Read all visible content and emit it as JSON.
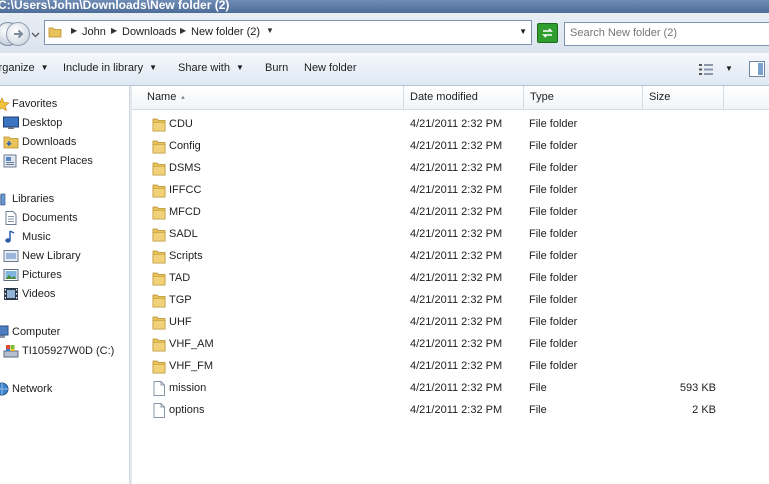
{
  "window": {
    "title": "C:\\Users\\John\\Downloads\\New folder (2)"
  },
  "address": {
    "crumbs": [
      "John",
      "Downloads",
      "New folder (2)"
    ]
  },
  "search": {
    "placeholder": "Search New folder (2)"
  },
  "toolbar": {
    "organize": "Organize",
    "include": "Include in library",
    "share": "Share with",
    "burn": "Burn",
    "newfolder": "New folder"
  },
  "nav": {
    "favorites": "Favorites",
    "desktop": "Desktop",
    "downloads": "Downloads",
    "recent": "Recent Places",
    "libraries": "Libraries",
    "documents": "Documents",
    "music": "Music",
    "newlibrary": "New Library",
    "pictures": "Pictures",
    "videos": "Videos",
    "computer": "Computer",
    "drive": "TI105927W0D (C:)",
    "network": "Network"
  },
  "columns": {
    "name": "Name",
    "date": "Date modified",
    "type": "Type",
    "size": "Size"
  },
  "files": [
    {
      "name": "CDU",
      "date": "4/21/2011 2:32 PM",
      "type": "File folder",
      "size": ""
    },
    {
      "name": "Config",
      "date": "4/21/2011 2:32 PM",
      "type": "File folder",
      "size": ""
    },
    {
      "name": "DSMS",
      "date": "4/21/2011 2:32 PM",
      "type": "File folder",
      "size": ""
    },
    {
      "name": "IFFCC",
      "date": "4/21/2011 2:32 PM",
      "type": "File folder",
      "size": ""
    },
    {
      "name": "MFCD",
      "date": "4/21/2011 2:32 PM",
      "type": "File folder",
      "size": ""
    },
    {
      "name": "SADL",
      "date": "4/21/2011 2:32 PM",
      "type": "File folder",
      "size": ""
    },
    {
      "name": "Scripts",
      "date": "4/21/2011 2:32 PM",
      "type": "File folder",
      "size": ""
    },
    {
      "name": "TAD",
      "date": "4/21/2011 2:32 PM",
      "type": "File folder",
      "size": ""
    },
    {
      "name": "TGP",
      "date": "4/21/2011 2:32 PM",
      "type": "File folder",
      "size": ""
    },
    {
      "name": "UHF",
      "date": "4/21/2011 2:32 PM",
      "type": "File folder",
      "size": ""
    },
    {
      "name": "VHF_AM",
      "date": "4/21/2011 2:32 PM",
      "type": "File folder",
      "size": ""
    },
    {
      "name": "VHF_FM",
      "date": "4/21/2011 2:32 PM",
      "type": "File folder",
      "size": ""
    },
    {
      "name": "mission",
      "date": "4/21/2011 2:32 PM",
      "type": "File",
      "size": "593 KB"
    },
    {
      "name": "options",
      "date": "4/21/2011 2:32 PM",
      "type": "File",
      "size": "2 KB"
    }
  ]
}
